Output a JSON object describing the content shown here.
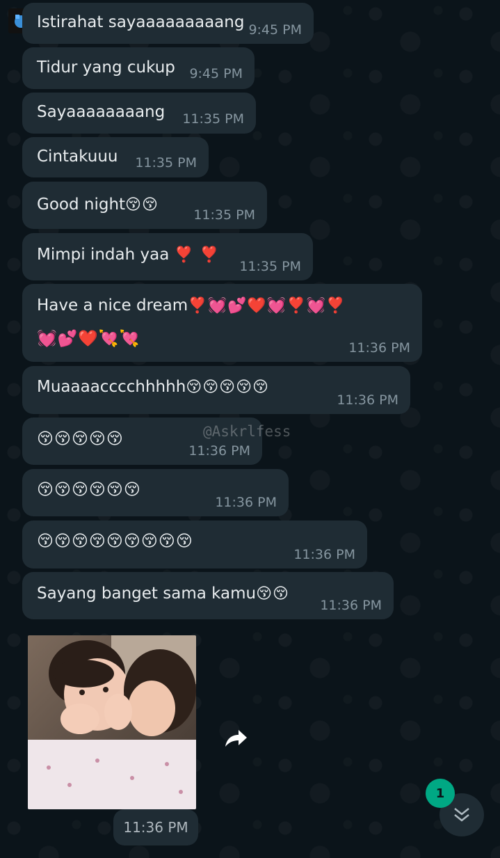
{
  "chat": {
    "watermark": "@Askrlfess",
    "messages": [
      {
        "text": "Istirahat sayaaaaaaaaang",
        "emoji": "",
        "time": "9:45 PM"
      },
      {
        "text": "Tidur yang cukup",
        "emoji": "",
        "time": "9:45 PM"
      },
      {
        "text": "Sayaaaaaaaang",
        "emoji": "",
        "time": "11:35 PM"
      },
      {
        "text": "Cintakuuu",
        "emoji": "",
        "time": "11:35 PM"
      },
      {
        "text": "Good night",
        "emoji": "😚😚",
        "time": "11:35 PM"
      },
      {
        "text": "Mimpi indah yaa ",
        "emoji": "❣️ ❣️",
        "time": "11:35 PM"
      },
      {
        "text": "Have a nice dream",
        "emoji": "❣️💓💕❤️💓❣️💓❣️",
        "emoji2": "💓💕❤️💘💘",
        "time": "11:36 PM"
      },
      {
        "text": "Muaaaacccchhhhh",
        "emoji": "😚😚😚😚😚",
        "time": "11:36 PM"
      },
      {
        "text": "",
        "emoji": "😚😚😚😚😚",
        "time": "11:36 PM"
      },
      {
        "text": "",
        "emoji": "😚😚😚😚😚😚",
        "time": "11:36 PM"
      },
      {
        "text": "",
        "emoji": "😚😚😚😚😚😚😚😚😚",
        "time": "11:36 PM"
      },
      {
        "text": "Sayang banget sama kamu",
        "emoji": "😚😚",
        "time": "11:36 PM"
      }
    ],
    "image_message": {
      "time": "11:36 PM"
    },
    "unread_count": "1",
    "icons": {
      "avatar": "avatar-icon",
      "forward": "forward-icon",
      "scroll": "chevron-double-down-icon"
    },
    "colors": {
      "background": "#0b141a",
      "bubble": "#1f2c34",
      "text": "#e9edef",
      "time": "#8696a0",
      "badge": "#00a884"
    }
  }
}
